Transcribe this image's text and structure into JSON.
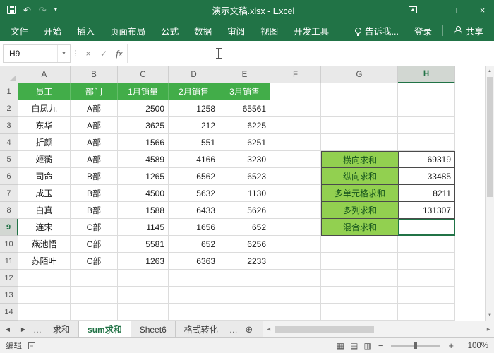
{
  "colors": {
    "accent": "#217346",
    "table_header_fill": "#42ad49",
    "summary_label_fill": "#92d050"
  },
  "titlebar": {
    "title": "演示文稿.xlsx - Excel",
    "undo_icon": "↶",
    "redo_icon": "↷",
    "customize_icon": "▾",
    "minimize_icon": "–",
    "maximize_icon": "□",
    "close_icon": "×"
  },
  "ribbon": {
    "tabs": [
      "文件",
      "开始",
      "插入",
      "页面布局",
      "公式",
      "数据",
      "审阅",
      "视图",
      "开发工具"
    ],
    "tell_me": "告诉我...",
    "sign_in": "登录",
    "share": "共享"
  },
  "formula_bar": {
    "name_box": "H9",
    "dropdown_icon": "▼",
    "separator_dots": "⋮",
    "cancel_icon": "×",
    "enter_icon": "✓",
    "fx_label": "fx",
    "formula_value": ""
  },
  "grid": {
    "column_headers": [
      "A",
      "B",
      "C",
      "D",
      "E",
      "F",
      "G",
      "H"
    ],
    "selected_column": "H",
    "row_count": 14,
    "selected_row": "9",
    "active_cell": "H9",
    "table_header": [
      "员工",
      "部门",
      "1月销量",
      "2月销售",
      "3月销售"
    ],
    "table_rows": [
      [
        "白凤九",
        "A部",
        2500,
        1258,
        65561
      ],
      [
        "东华",
        "A部",
        3625,
        212,
        6225
      ],
      [
        "折颜",
        "A部",
        1566,
        551,
        6251
      ],
      [
        "姬蘅",
        "A部",
        4589,
        4166,
        3230
      ],
      [
        "司命",
        "B部",
        1265,
        6562,
        6523
      ],
      [
        "成玉",
        "B部",
        4500,
        5632,
        1130
      ],
      [
        "白真",
        "B部",
        1588,
        6433,
        5626
      ],
      [
        "连宋",
        "C部",
        1145,
        1656,
        652
      ],
      [
        "燕池悟",
        "C部",
        5581,
        652,
        6256
      ],
      [
        "苏陌叶",
        "C部",
        1263,
        6363,
        2233
      ]
    ],
    "summary_rows": [
      {
        "label": "横向求和",
        "value": "69319"
      },
      {
        "label": "纵向求和",
        "value": "33485"
      },
      {
        "label": "多单元格求和",
        "value": "8211"
      },
      {
        "label": "多列求和",
        "value": "131307"
      },
      {
        "label": "混合求和",
        "value": ""
      }
    ]
  },
  "sheet_bar": {
    "nav_left_icon": "◀",
    "nav_right_icon": "▶",
    "more_left": "…",
    "tabs": [
      {
        "label": "求和",
        "active": false
      },
      {
        "label": "sum求和",
        "active": true
      },
      {
        "label": "Sheet6",
        "active": false
      },
      {
        "label": "格式转化",
        "active": false
      }
    ],
    "more_right": "…",
    "add_icon": "⊕"
  },
  "scrollbars": {
    "up_icon": "▲",
    "down_icon": "▼",
    "left_icon": "◀",
    "right_icon": "▶"
  },
  "status_bar": {
    "mode": "编辑",
    "view_icons": [
      "▦",
      "▤",
      "▥"
    ],
    "zoom_out_icon": "−",
    "zoom_in_icon": "+",
    "zoom_level": "100%"
  }
}
